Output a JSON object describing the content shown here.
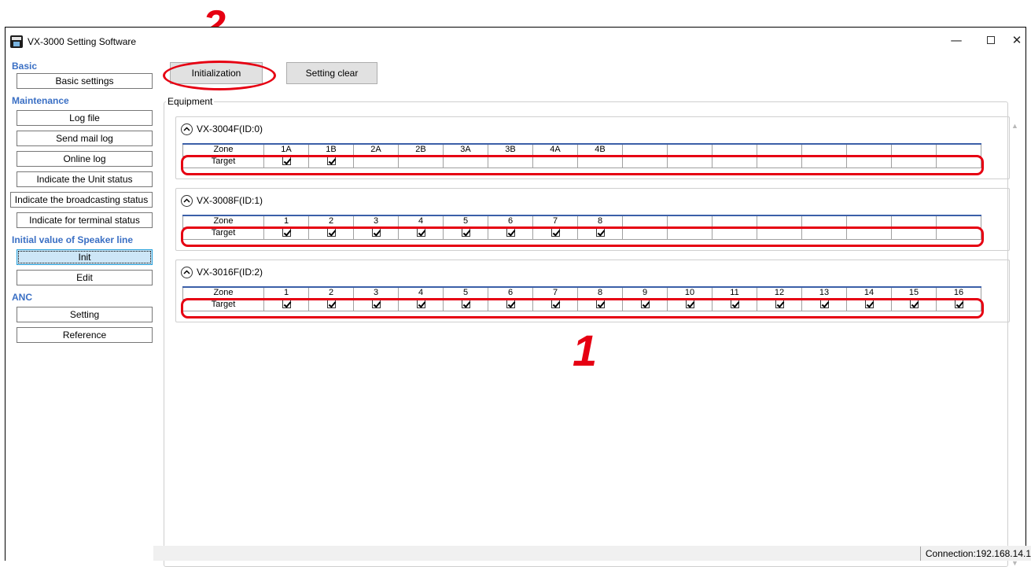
{
  "annotations": {
    "step_1": "1",
    "step_2": "2"
  },
  "window": {
    "title": "VX-3000 Setting Software"
  },
  "sidebar": {
    "basic": {
      "title": "Basic",
      "items": [
        "Basic settings"
      ]
    },
    "maintenance": {
      "title": "Maintenance",
      "items": [
        "Log file",
        "Send mail log",
        "Online log",
        "Indicate the Unit status",
        "Indicate the broadcasting status",
        "Indicate for terminal status"
      ]
    },
    "speaker": {
      "title": "Initial value of Speaker line",
      "items": [
        "Init",
        "Edit"
      ],
      "active": "Init"
    },
    "anc": {
      "title": "ANC",
      "items": [
        "Setting",
        "Reference"
      ]
    }
  },
  "toolbar": {
    "init_label": "Initialization",
    "clear_label": "Setting clear"
  },
  "equipment": {
    "legend": "Equipment",
    "row_labels": {
      "zone": "Zone",
      "target": "Target"
    },
    "groups": [
      {
        "name": "VX-3004F(ID:0)",
        "zones": [
          "1A",
          "1B",
          "2A",
          "2B",
          "3A",
          "3B",
          "4A",
          "4B",
          "",
          "",
          "",
          "",
          "",
          "",
          "",
          ""
        ],
        "checked": [
          true,
          true,
          false,
          false,
          false,
          false,
          false,
          false,
          false,
          false,
          false,
          false,
          false,
          false,
          false,
          false
        ]
      },
      {
        "name": "VX-3008F(ID:1)",
        "zones": [
          "1",
          "2",
          "3",
          "4",
          "5",
          "6",
          "7",
          "8",
          "",
          "",
          "",
          "",
          "",
          "",
          "",
          ""
        ],
        "checked": [
          true,
          true,
          true,
          true,
          true,
          true,
          true,
          true,
          false,
          false,
          false,
          false,
          false,
          false,
          false,
          false
        ]
      },
      {
        "name": "VX-3016F(ID:2)",
        "zones": [
          "1",
          "2",
          "3",
          "4",
          "5",
          "6",
          "7",
          "8",
          "9",
          "10",
          "11",
          "12",
          "13",
          "14",
          "15",
          "16"
        ],
        "checked": [
          true,
          true,
          true,
          true,
          true,
          true,
          true,
          true,
          true,
          true,
          true,
          true,
          true,
          true,
          true,
          true
        ]
      }
    ]
  },
  "status": {
    "connection": "Connection:192.168.14.1"
  },
  "colors": {
    "annotation": "#e60012",
    "section_title": "#3a6fc4",
    "active_item": "#cde6f7"
  }
}
